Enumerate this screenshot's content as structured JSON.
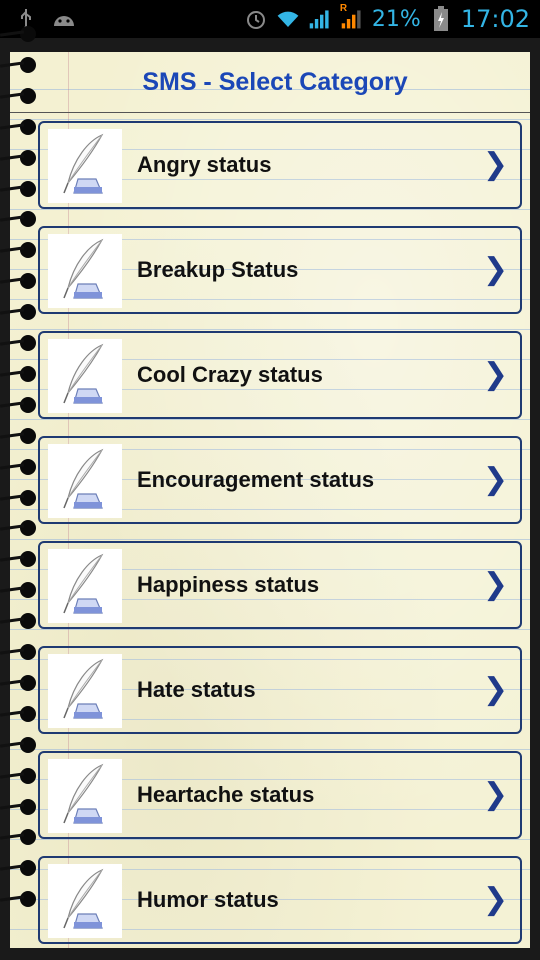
{
  "status_bar": {
    "battery": "21%",
    "time": "17:02",
    "roaming": "R",
    "icons": [
      "usb-icon",
      "android-icon",
      "alarm-icon",
      "wifi-icon",
      "signal-icon",
      "signal-roaming-icon",
      "battery-charging-icon"
    ]
  },
  "header": {
    "title": "SMS - Select Category"
  },
  "categories": [
    {
      "label": "Angry status",
      "icon": "quill-ink-icon"
    },
    {
      "label": "Breakup Status",
      "icon": "quill-ink-icon"
    },
    {
      "label": "Cool Crazy status",
      "icon": "quill-ink-icon"
    },
    {
      "label": "Encouragement status",
      "icon": "quill-ink-icon"
    },
    {
      "label": "Happiness status",
      "icon": "quill-ink-icon"
    },
    {
      "label": "Hate status",
      "icon": "quill-ink-icon"
    },
    {
      "label": "Heartache status",
      "icon": "quill-ink-icon"
    },
    {
      "label": "Humor status",
      "icon": "quill-ink-icon"
    }
  ],
  "chevron": "❯",
  "colors": {
    "title": "#1b47b7",
    "item_border": "#1f3a72",
    "status_accent": "#33b5e5",
    "paper": "#f4f1d2"
  }
}
